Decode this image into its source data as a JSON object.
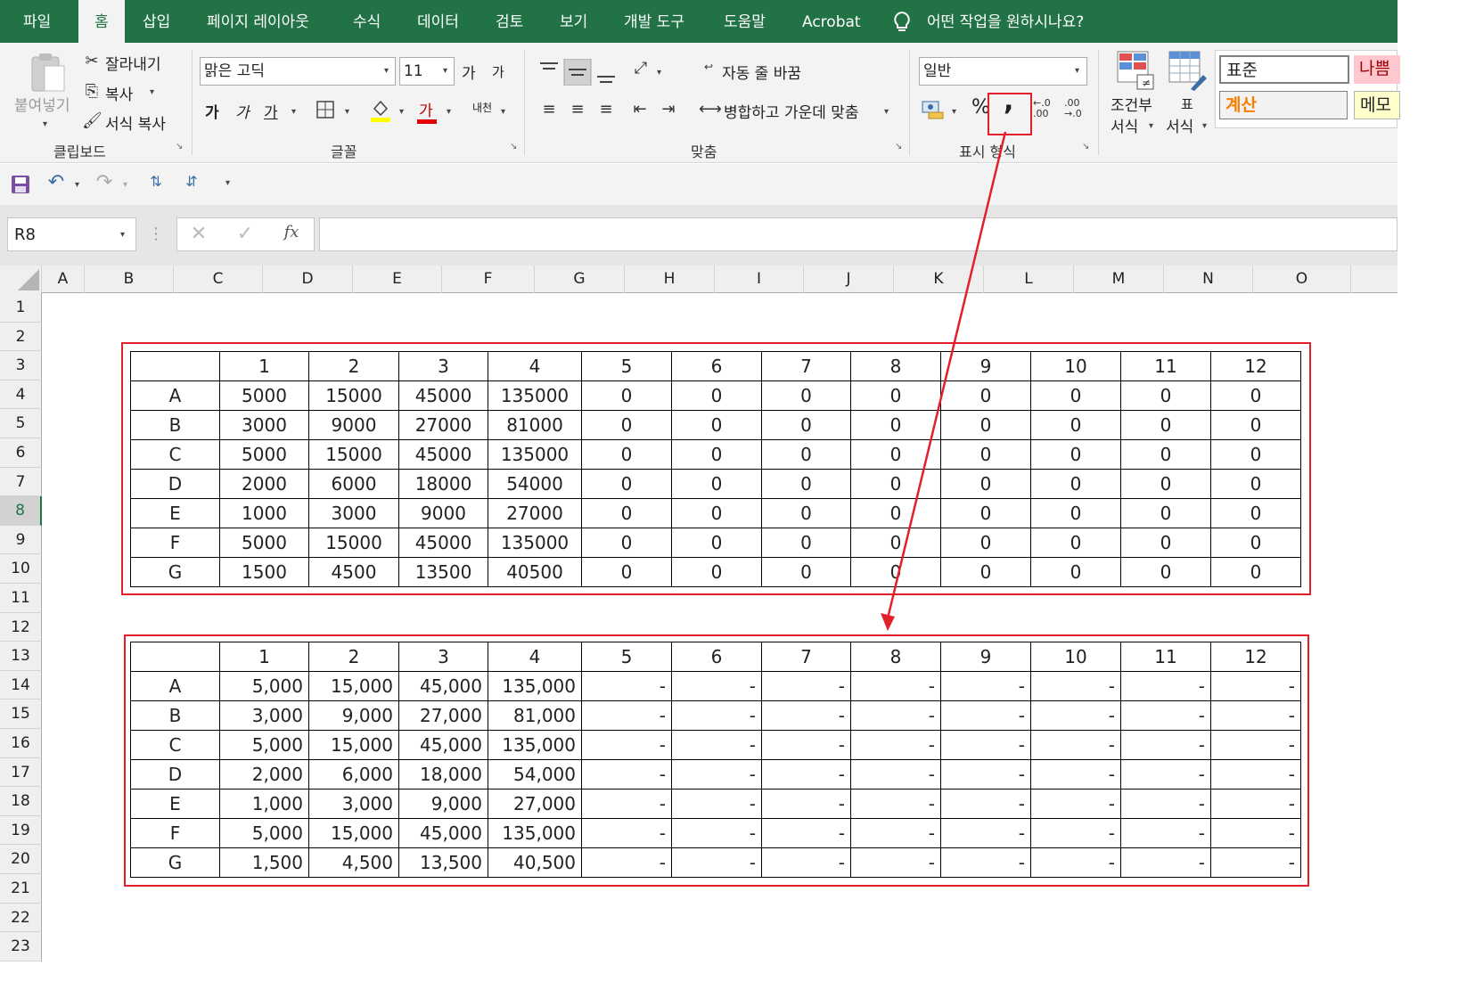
{
  "tabs": [
    "파일",
    "홈",
    "삽입",
    "페이지 레이아웃",
    "수식",
    "데이터",
    "검토",
    "보기",
    "개발 도구",
    "도움말",
    "Acrobat"
  ],
  "active_tab": "홈",
  "tell_me": "어떤 작업을 원하시나요?",
  "clipboard": {
    "paste": "붙여넣기",
    "cut": "잘라내기",
    "copy": "복사",
    "format_painter": "서식 복사",
    "title": "클립보드"
  },
  "font": {
    "name": "맑은 고딕",
    "size": "11",
    "grow": "가",
    "shrink": "가",
    "bold": "가",
    "italic": "가",
    "underline": "가",
    "color_glyph": "가",
    "phonetic": "내천",
    "title": "글꼴"
  },
  "alignment": {
    "wrap": "자동 줄 바꿈",
    "merge": "병합하고 가운데 맞춤",
    "title": "맞춤"
  },
  "number": {
    "format": "일반",
    "percent": "%",
    "comma": ",",
    "title": "표시 형식"
  },
  "styles": {
    "conditional": [
      "조건부",
      "서식"
    ],
    "table": [
      "표",
      "서식"
    ],
    "normal": "표준",
    "bad": "나쁨",
    "calc": "계산",
    "note": "메모"
  },
  "formula_bar": {
    "name_box": "R8",
    "fx": "fx",
    "content": ""
  },
  "columns": [
    "A",
    "B",
    "C",
    "D",
    "E",
    "F",
    "G",
    "H",
    "I",
    "J",
    "K",
    "L",
    "M",
    "N",
    "O"
  ],
  "rows": [
    "1",
    "2",
    "3",
    "4",
    "5",
    "6",
    "7",
    "8",
    "9",
    "10",
    "11",
    "12",
    "13",
    "14",
    "15",
    "16",
    "17",
    "18",
    "19",
    "20",
    "21",
    "22",
    "23"
  ],
  "selected_row": "8",
  "table1": {
    "header": [
      "",
      "1",
      "2",
      "3",
      "4",
      "5",
      "6",
      "7",
      "8",
      "9",
      "10",
      "11",
      "12"
    ],
    "rows": [
      [
        "A",
        "5000",
        "15000",
        "45000",
        "135000",
        "0",
        "0",
        "0",
        "0",
        "0",
        "0",
        "0",
        "0"
      ],
      [
        "B",
        "3000",
        "9000",
        "27000",
        "81000",
        "0",
        "0",
        "0",
        "0",
        "0",
        "0",
        "0",
        "0"
      ],
      [
        "C",
        "5000",
        "15000",
        "45000",
        "135000",
        "0",
        "0",
        "0",
        "0",
        "0",
        "0",
        "0",
        "0"
      ],
      [
        "D",
        "2000",
        "6000",
        "18000",
        "54000",
        "0",
        "0",
        "0",
        "0",
        "0",
        "0",
        "0",
        "0"
      ],
      [
        "E",
        "1000",
        "3000",
        "9000",
        "27000",
        "0",
        "0",
        "0",
        "0",
        "0",
        "0",
        "0",
        "0"
      ],
      [
        "F",
        "5000",
        "15000",
        "45000",
        "135000",
        "0",
        "0",
        "0",
        "0",
        "0",
        "0",
        "0",
        "0"
      ],
      [
        "G",
        "1500",
        "4500",
        "13500",
        "40500",
        "0",
        "0",
        "0",
        "0",
        "0",
        "0",
        "0",
        "0"
      ]
    ]
  },
  "table2": {
    "header": [
      "",
      "1",
      "2",
      "3",
      "4",
      "5",
      "6",
      "7",
      "8",
      "9",
      "10",
      "11",
      "12"
    ],
    "rows": [
      [
        "A",
        "5,000",
        "15,000",
        "45,000",
        "135,000",
        "-",
        "-",
        "-",
        "-",
        "-",
        "-",
        "-",
        "-"
      ],
      [
        "B",
        "3,000",
        "9,000",
        "27,000",
        "81,000",
        "-",
        "-",
        "-",
        "-",
        "-",
        "-",
        "-",
        "-"
      ],
      [
        "C",
        "5,000",
        "15,000",
        "45,000",
        "135,000",
        "-",
        "-",
        "-",
        "-",
        "-",
        "-",
        "-",
        "-"
      ],
      [
        "D",
        "2,000",
        "6,000",
        "18,000",
        "54,000",
        "-",
        "-",
        "-",
        "-",
        "-",
        "-",
        "-",
        "-"
      ],
      [
        "E",
        "1,000",
        "3,000",
        "9,000",
        "27,000",
        "-",
        "-",
        "-",
        "-",
        "-",
        "-",
        "-",
        "-"
      ],
      [
        "F",
        "5,000",
        "15,000",
        "45,000",
        "135,000",
        "-",
        "-",
        "-",
        "-",
        "-",
        "-",
        "-",
        "-"
      ],
      [
        "G",
        "1,500",
        "4,500",
        "13,500",
        "40,500",
        "-",
        "-",
        "-",
        "-",
        "-",
        "-",
        "-",
        "-"
      ]
    ]
  },
  "colors": {
    "excel_green": "#217346",
    "annotation_red": "#e3202a"
  }
}
